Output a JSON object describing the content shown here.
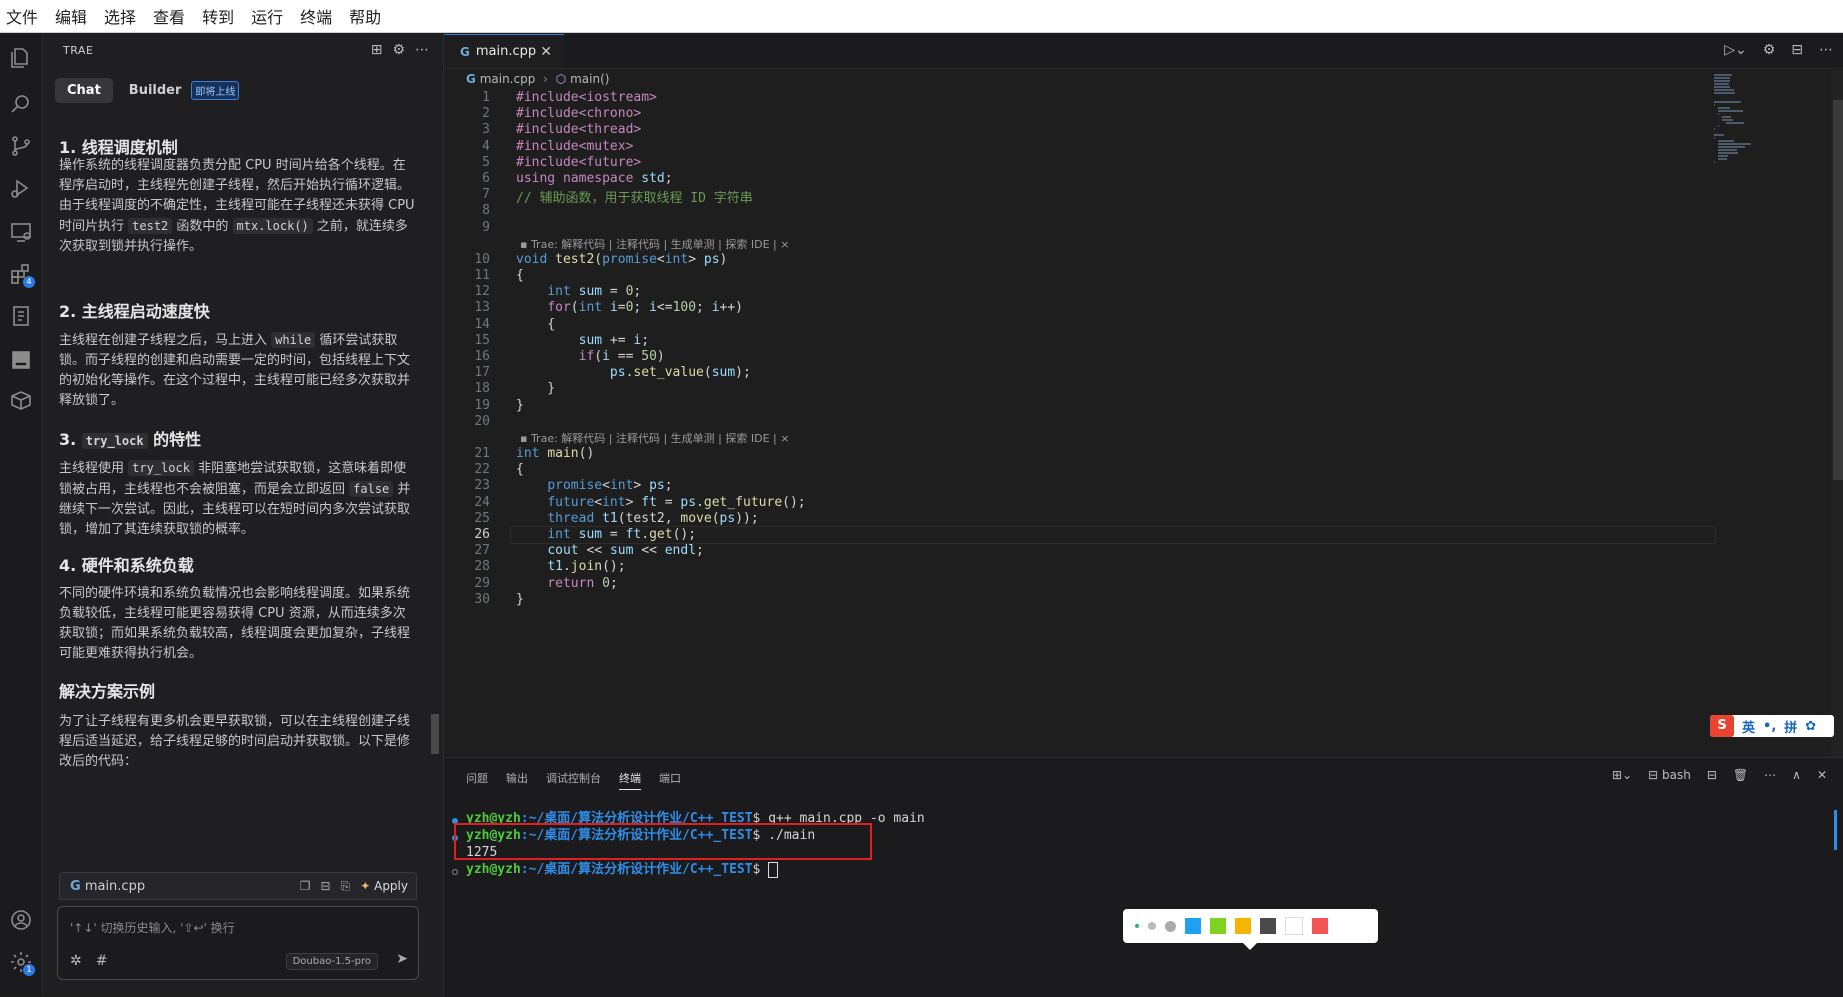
{
  "menu": [
    "文件",
    "编辑",
    "选择",
    "查看",
    "转到",
    "运行",
    "终端",
    "帮助"
  ],
  "activity_icons": [
    "explorer-icon",
    "search-icon",
    "source-control-icon",
    "run-debug-icon",
    "remote-explorer-icon",
    "extensions-icon",
    "testing-icon",
    "panel-icon",
    "packages-icon",
    "account-icon",
    "settings-icon"
  ],
  "activity_badges": {
    "extensions": "4",
    "settings": "1"
  },
  "chat": {
    "header": "TRAE",
    "tab_chat": "Chat",
    "tab_builder": "Builder",
    "builder_badge": "即将上线",
    "sections": [
      {
        "title": "1. 线程调度机制",
        "text": "操作系统的线程调度器负责分配 CPU 时间片给各个线程。在程序启动时，主线程先创建子线程，然后开始执行循环逻辑。由于线程调度的不确定性，主线程可能在子线程还未获得 CPU 时间片执行 test2 函数中的 mtx.lock() 之前，就连续多次获取到锁并执行操作。"
      },
      {
        "title": "2. 主线程启动速度快",
        "text": "主线程在创建子线程之后，马上进入 while 循环尝试获取锁。而子线程的创建和启动需要一定的时间，包括线程上下文的初始化等操作。在这个过程中，主线程可能已经多次获取并释放锁了。"
      },
      {
        "title_prefix": "3. ",
        "title_code": "try_lock",
        "title_suffix": " 的特性",
        "text": "主线程使用 try_lock 非阻塞地尝试获取锁，这意味着即使锁被占用，主线程也不会被阻塞，而是会立即返回 false 并继续下一次尝试。因此，主线程可以在短时间内多次尝试获取锁，增加了其连续获取锁的概率。"
      },
      {
        "title": "4. 硬件和系统负载",
        "text": "不同的硬件环境和系统负载情况也会影响线程调度。如果系统负载较低，主线程可能更容易获得 CPU 资源，从而连续多次获取锁；而如果系统负载较高，线程调度会更加复杂，子线程可能更难获得执行机会。"
      },
      {
        "title": "解决方案示例",
        "text": "为了让子线程有更多机会更早获取锁，可以在主线程创建子线程后适当延迟，给子线程足够的时间启动并获取锁。以下是修改后的代码："
      }
    ],
    "codebox_file": "main.cpp",
    "apply_label": "Apply",
    "input_placeholder": "'↑↓' 切换历史输入, '⇧↩' 换行",
    "model": "Doubao-1.5-pro"
  },
  "editor": {
    "tab": "main.cpp",
    "breadcrumb_file": "main.cpp",
    "breadcrumb_symbol": "main()",
    "codelens": "Trae: 解释代码 | 注释代码 | 生成单测 | 探索 IDE | ×",
    "current_line": 26,
    "lines": [
      "#include<iostream>",
      "#include<chrono>",
      "#include<thread>",
      "#include<mutex>",
      "#include<future>",
      "using namespace std;",
      "// 辅助函数，用于获取线程 ID 字符串",
      "",
      "",
      "void test2(promise<int> ps)",
      "{",
      "    int sum = 0;",
      "    for(int i=0; i<=100; i++)",
      "    {",
      "        sum += i;",
      "        if(i == 50)",
      "            ps.set_value(sum);",
      "    }",
      "}",
      "",
      "int main()",
      "{",
      "    promise<int> ps;",
      "    future<int> ft = ps.get_future();",
      "    thread t1(test2, move(ps));",
      "    int sum = ft.get();",
      "    cout << sum << endl;",
      "    t1.join();",
      "    return 0;",
      "}"
    ]
  },
  "ime": {
    "logo": "S",
    "mode": "英",
    "punct": "•,",
    "input": "拼"
  },
  "panel": {
    "tabs": [
      "问题",
      "输出",
      "调试控制台",
      "终端",
      "端口"
    ],
    "active_tab": "终端",
    "shell": "bash",
    "terminal": [
      {
        "user": "yzh@yzh",
        "path": ":~/桌面/算法分析设计作业/C++_TEST",
        "cmd": "$ g++ main.cpp -o main"
      },
      {
        "user": "yzh@yzh",
        "path": ":~/桌面/算法分析设计作业/C++_TEST",
        "cmd": "$ ./main"
      },
      {
        "output": "1275"
      },
      {
        "user": "yzh@yzh",
        "path": ":~/桌面/算法分析设计作业/C++_TEST",
        "cmd": "$ "
      }
    ]
  },
  "palette_colors": [
    "#1ea1f2",
    "#7ed321",
    "#f5b400",
    "#4a4a4a",
    "#ffffff",
    "#f05454"
  ]
}
